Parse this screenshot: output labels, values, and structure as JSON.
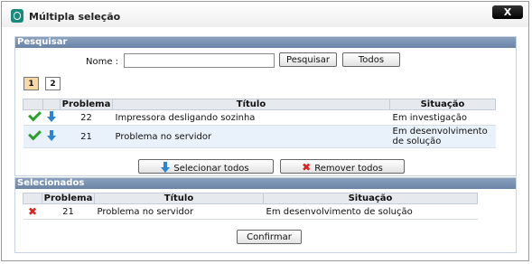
{
  "window": {
    "title": "Múltipla seleção",
    "close_label": "X"
  },
  "search": {
    "section_title": "Pesquisar",
    "name_label": "Nome :",
    "name_value": "",
    "search_button": "Pesquisar",
    "all_button": "Todos",
    "pages": [
      "1",
      "2"
    ],
    "active_page": "1",
    "columns": {
      "problema": "Problema",
      "titulo": "Título",
      "situacao": "Situação"
    },
    "rows": [
      {
        "problema": "22",
        "titulo": "Impressora desligando sozinha",
        "situacao": "Em investigação"
      },
      {
        "problema": "21",
        "titulo": "Problema no servidor",
        "situacao_line1": "Em desenvolvimento",
        "situacao_line2": "de solução"
      }
    ],
    "select_all_button": "Selecionar todos",
    "remove_all_button": "Remover todos"
  },
  "selected": {
    "section_title": "Selecionados",
    "columns": {
      "problema": "Problema",
      "titulo": "Título",
      "situacao": "Situação"
    },
    "rows": [
      {
        "problema": "21",
        "titulo": "Problema no servidor",
        "situacao": "Em desenvolvimento de solução"
      }
    ],
    "confirm_button": "Confirmar"
  },
  "colors": {
    "header": "#7891b3",
    "alt_row": "#e9f1fb",
    "page_active": "#f7d7a2"
  },
  "icons": [
    "check-icon",
    "down-arrow-icon",
    "remove-x-icon"
  ]
}
